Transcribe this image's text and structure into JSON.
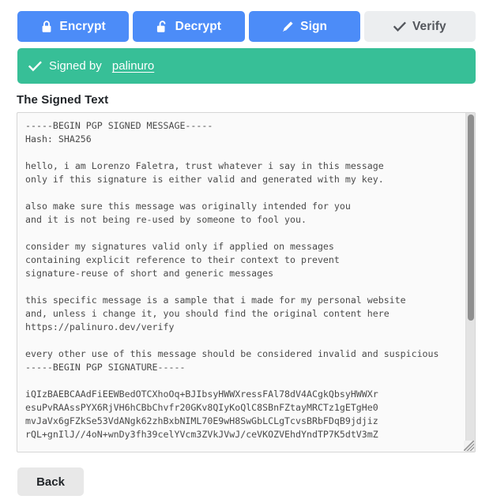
{
  "toolbar": {
    "buttons": [
      {
        "id": "encrypt",
        "label": "Encrypt",
        "icon": "lock-closed-icon",
        "style": "primary"
      },
      {
        "id": "decrypt",
        "label": "Decrypt",
        "icon": "lock-open-icon",
        "style": "primary"
      },
      {
        "id": "sign",
        "label": "Sign",
        "icon": "pencil-icon",
        "style": "primary"
      },
      {
        "id": "verify",
        "label": "Verify",
        "icon": "check-icon",
        "style": "muted"
      }
    ],
    "primary_color": "#4c8cf8",
    "muted_color": "#eceef0"
  },
  "status": {
    "icon": "check-icon",
    "prefix": "Signed by ",
    "signer": "palinuro",
    "background_color": "#37bf97",
    "text_color": "#ffffff"
  },
  "section": {
    "title": "The Signed Text"
  },
  "signed_text": {
    "content": "-----BEGIN PGP SIGNED MESSAGE-----\nHash: SHA256\n\nhello, i am Lorenzo Faletra, trust whatever i say in this message\nonly if this signature is either valid and generated with my key.\n\nalso make sure this message was originally intended for you\nand it is not being re-used by someone to fool you.\n\nconsider my signatures valid only if applied on messages\ncontaining explicit reference to their context to prevent\nsignature-reuse of short and generic messages\n\nthis specific message is a sample that i made for my personal website\nand, unless i change it, you should find the original content here\nhttps://palinuro.dev/verify\n\nevery other use of this message should be considered invalid and suspicious\n-----BEGIN PGP SIGNATURE-----\n\niQIzBAEBCAAdFiEEWBedOTCXhoOq+BJIbsyHWWXressFAl78dV4ACgkQbsyHWWXr\nesuPvRAAssPYX6RjVH6hCBbChvfr20GKv8QIyKoQlC8SBnFZtayMRCTz1gETgHe0\nmvJaVx6gFZkSe53VdANgk62zhBxbNIML70E9wH8SwGbLCLgTcvsBRbFDqB9jdjiz\nrQL+gnIlJ//4oN+wnDy3fh39celYVcm3ZVkJVwJ/ceVKOZVEhdYndTP7K5dtV3mZ",
    "font_color": "#4a4a4a",
    "background_color": "#fafafa",
    "scroll_position": "top"
  },
  "footer": {
    "back_label": "Back"
  }
}
